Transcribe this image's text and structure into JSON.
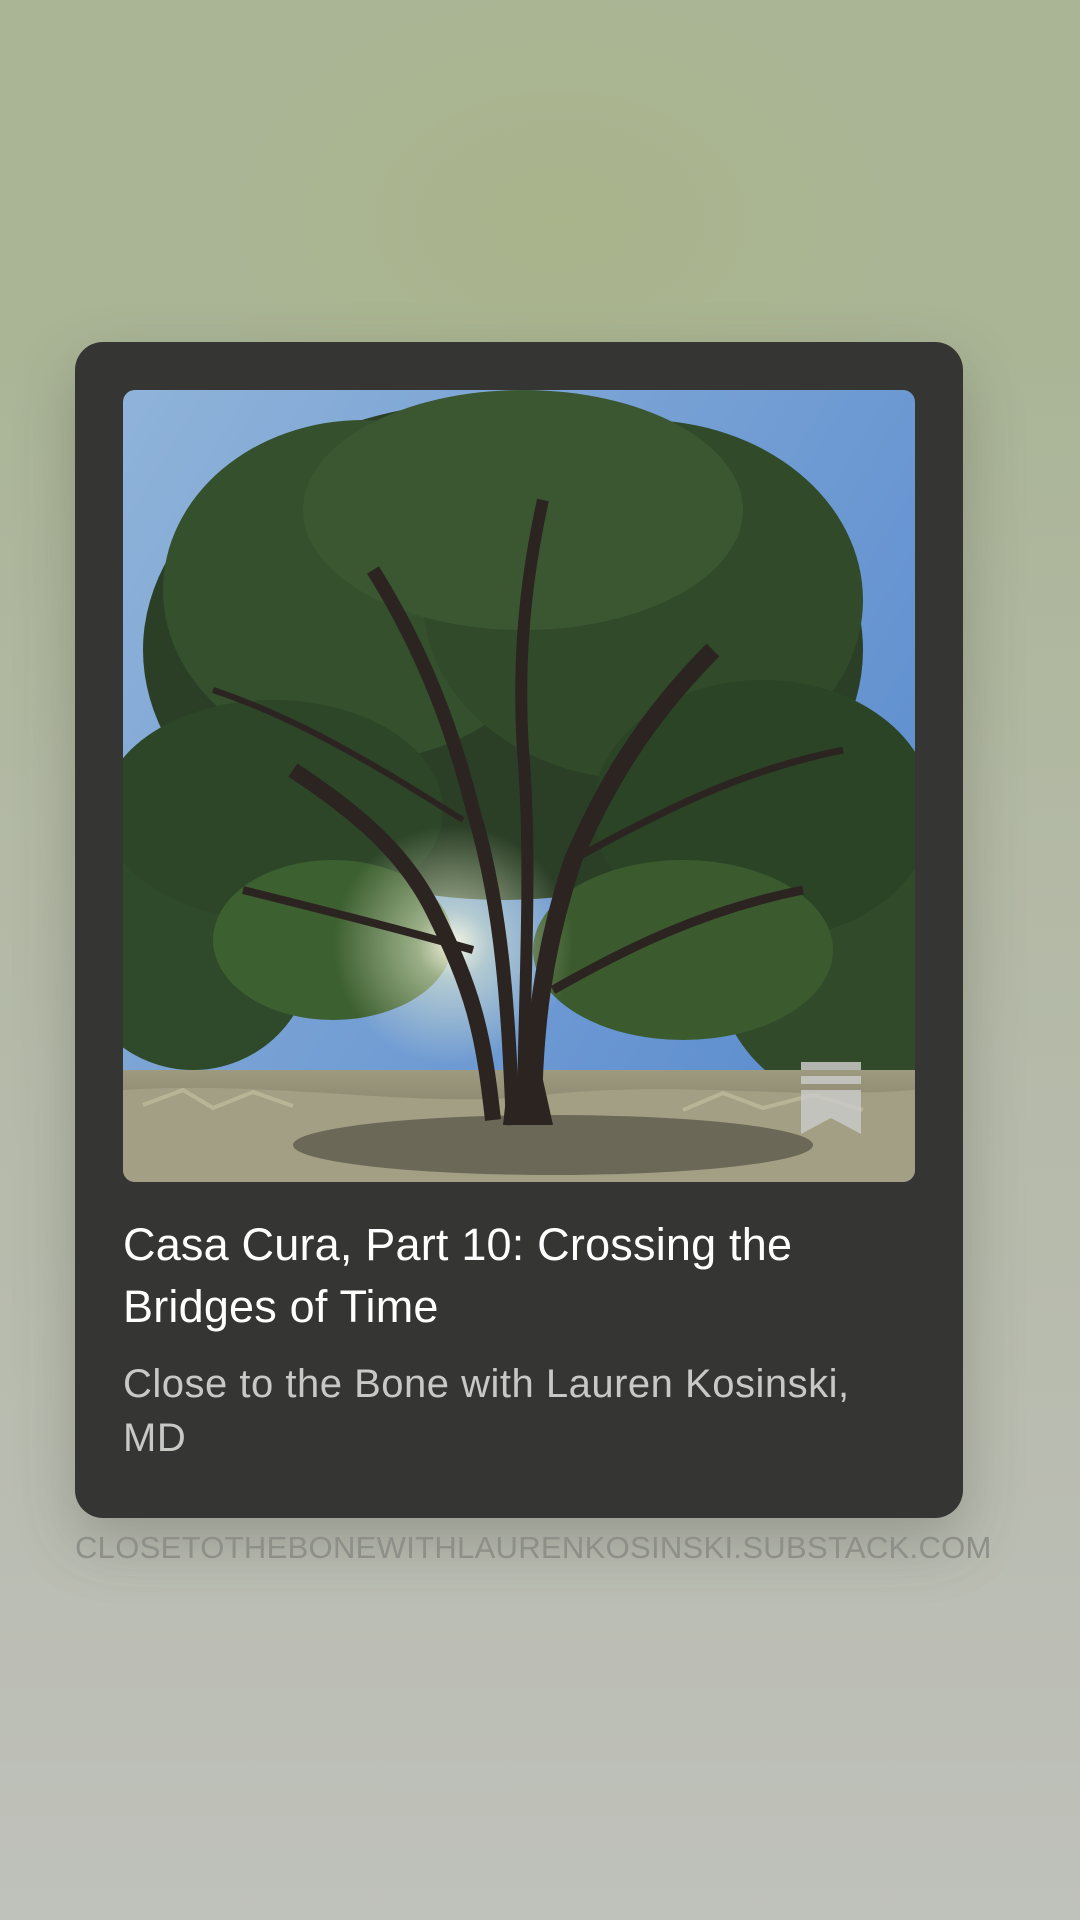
{
  "card": {
    "image_alt": "Large oak tree with sunlight behind branches",
    "title": "Casa Cura, Part 10: Crossing the Bridges of Time",
    "publication": "Close to the Bone with Lauren Kosinski, MD"
  },
  "link": {
    "domain": "CLOSETOTHEBONEWITHLAURENKOSINSKI.SUBSTACK.COM"
  },
  "icons": {
    "badge": "substack-logo-icon"
  },
  "colors": {
    "card_background": "#353534",
    "title": "#ffffff",
    "subtitle": "#c8c8c5",
    "domain": "#8d8f88"
  }
}
